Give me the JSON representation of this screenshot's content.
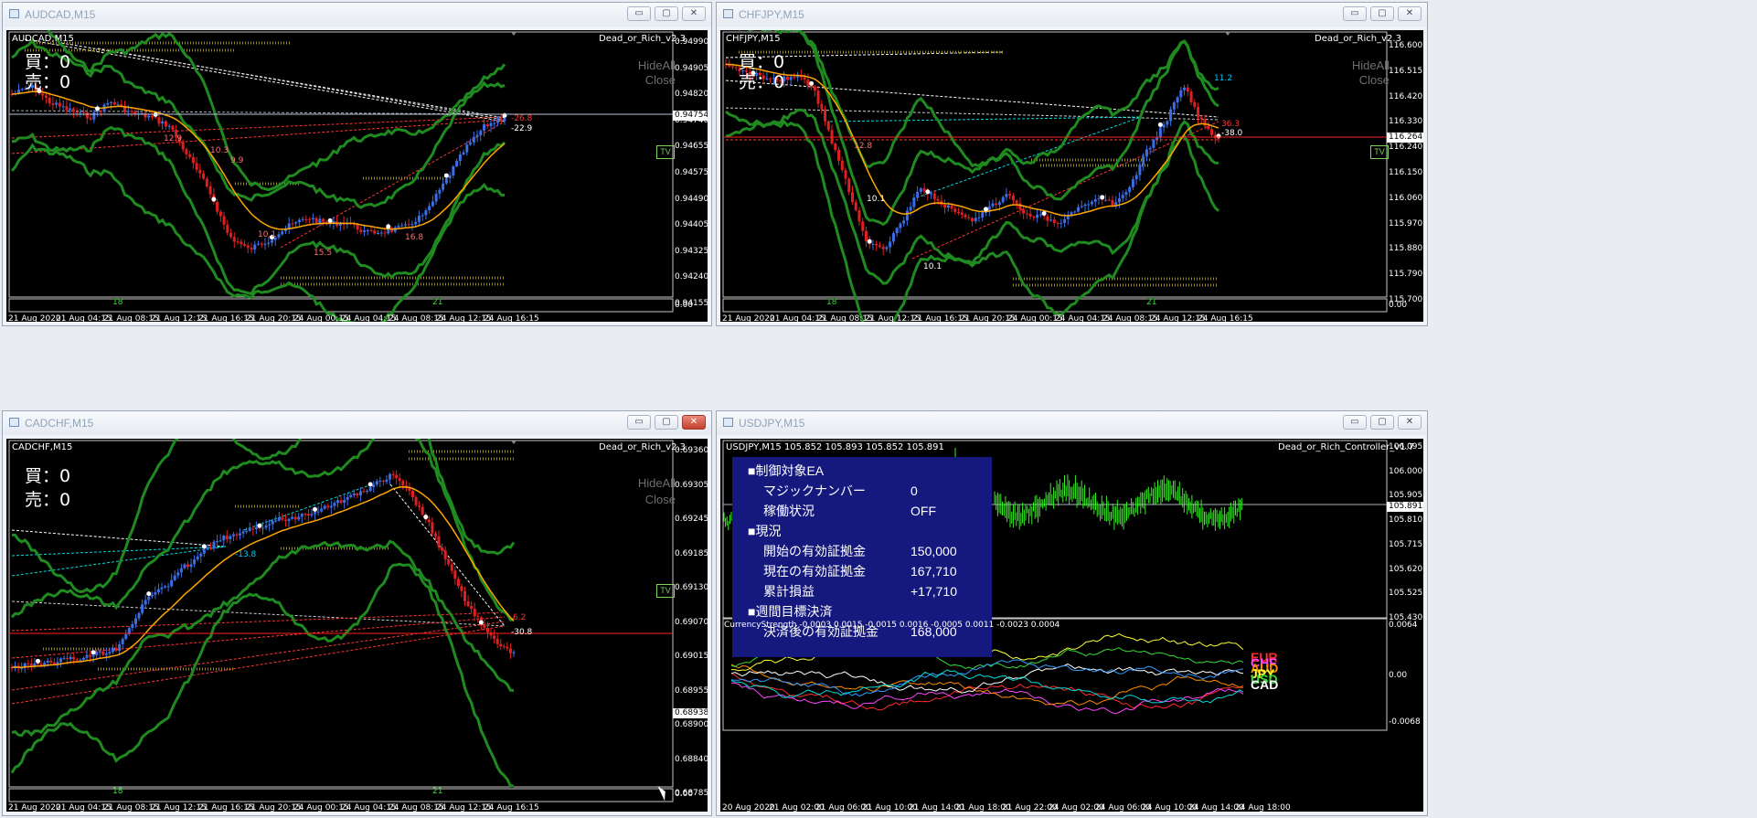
{
  "windows": {
    "audcad": {
      "title": "AUDCAD,M15",
      "symbol_label": "AUDCAD,M15",
      "ea_label": "Dead_or_Rich_v2.3",
      "buy": "買：0",
      "sell": "売：0",
      "hide_all": "HideAll",
      "close_all": "Close",
      "tv": "TV",
      "y_ticks": [
        "0.94990",
        "0.94905",
        "0.94820",
        "0.94740",
        "0.94655",
        "0.94575",
        "0.94490",
        "0.94405",
        "0.94325",
        "0.94240",
        "0.94155"
      ],
      "current_price": "0.94754",
      "x_ticks": [
        "21 Aug 2020",
        "21 Aug 04:15",
        "21 Aug 08:15",
        "21 Aug 12:15",
        "21 Aug 16:15",
        "21 Aug 20:15",
        "24 Aug 00:15",
        "24 Aug 04:15",
        "24 Aug 08:15",
        "24 Aug 12:15",
        "24 Aug 16:15"
      ],
      "sub_zero": "0.00",
      "sub_marks": [
        "18",
        "21"
      ],
      "annotations": [
        "12.9",
        "10.3",
        "9.9",
        "10.1",
        "15.5",
        "16.8",
        "-26.8",
        "-22.9"
      ]
    },
    "chfjpy": {
      "title": "CHFJPY,M15",
      "symbol_label": "CHFJPY,M15",
      "ea_label": "Dead_or_Rich_v2.3",
      "buy": "買：0",
      "sell": "売：0",
      "hide_all": "HideAll",
      "close_all": "Close",
      "tv": "TV",
      "y_ticks": [
        "116.600",
        "116.515",
        "116.420",
        "116.330",
        "116.240",
        "116.150",
        "116.060",
        "115.970",
        "115.880",
        "115.790",
        "115.700"
      ],
      "current_price": "116.264",
      "x_ticks": [
        "21 Aug 2020",
        "21 Aug 04:15",
        "21 Aug 08:15",
        "21 Aug 12:15",
        "21 Aug 16:15",
        "21 Aug 20:15",
        "24 Aug 00:15",
        "24 Aug 04:15",
        "24 Aug 08:15",
        "24 Aug 12:15",
        "24 Aug 16:15"
      ],
      "sub_zero": "0.00",
      "sub_marks": [
        "18",
        "21"
      ],
      "annotations": [
        "11.2",
        "12.8",
        "10.1",
        "10.1",
        "36.3",
        "-38.0"
      ]
    },
    "cadchf": {
      "title": "CADCHF,M15",
      "symbol_label": "CADCHF,M15",
      "ea_label": "Dead_or_Rich_v2.3",
      "buy": "買：0",
      "sell": "売：0",
      "hide_all": "HideAll",
      "close_all": "Close",
      "tv": "TV",
      "y_ticks": [
        "0.69360",
        "0.69305",
        "0.69245",
        "0.69185",
        "0.69130",
        "0.69070",
        "0.69015",
        "0.68955",
        "0.68900",
        "0.68840",
        "0.68785"
      ],
      "current_price": "0.68938",
      "x_ticks": [
        "21 Aug 2020",
        "21 Aug 04:15",
        "21 Aug 08:15",
        "21 Aug 12:15",
        "21 Aug 16:15",
        "21 Aug 20:15",
        "24 Aug 00:15",
        "24 Aug 04:15",
        "24 Aug 08:15",
        "24 Aug 12:15",
        "24 Aug 16:15"
      ],
      "sub_zero": "0.00",
      "sub_marks": [
        "18",
        "21"
      ],
      "annotations": [
        "-13.8",
        "6.2",
        "-30.8"
      ]
    },
    "usdjpy": {
      "title": "USDJPY,M15",
      "symbol_label": "USDJPY,M15  105.852 105.893 105.852 105.891",
      "ea_label": "Dead_or_Rich_Controller_v1.7",
      "y_ticks": [
        "106.095",
        "106.000",
        "105.905",
        "105.810",
        "105.715",
        "105.620",
        "105.525",
        "105.430"
      ],
      "current_price": "105.891",
      "panel": {
        "sec1": "■制御対象EA",
        "magic_label": "マジックナンバー",
        "magic_value": "0",
        "status_label": "稼働状況",
        "status_value": "OFF",
        "sec2": "■現況",
        "start_equity_label": "開始の有効証拠金",
        "start_equity_value": "150,000",
        "cur_equity_label": "現在の有効証拠金",
        "cur_equity_value": "167,710",
        "pnl_label": "累計損益",
        "pnl_value": "+17,710",
        "sec3": "■週間目標決済",
        "after_label": "決済後の有効証拠金",
        "after_value": "168,000"
      },
      "cs_label": "CurrencyStrength -0.0003 0.0015 -0.0015 0.0016 -0.0005 0.0011 -0.0023 0.0004",
      "cs_ticks": [
        "0.0064",
        "0.00",
        "-0.0068"
      ],
      "currencies": [
        {
          "name": "EUR",
          "color": "#ff2a2a"
        },
        {
          "name": "CHF",
          "color": "#ff44ff"
        },
        {
          "name": "AUD",
          "color": "#ff8c00"
        },
        {
          "name": "JPY",
          "color": "#ffff33"
        },
        {
          "name": "USD",
          "color": "#33dd33"
        },
        {
          "name": "CAD",
          "color": "#ffffff"
        }
      ],
      "x_ticks": [
        "20 Aug 2020",
        "21 Aug 02:00",
        "21 Aug 06:00",
        "21 Aug 10:00",
        "21 Aug 14:00",
        "21 Aug 18:00",
        "21 Aug 22:00",
        "24 Aug 02:00",
        "24 Aug 06:00",
        "24 Aug 10:00",
        "24 Aug 14:00",
        "24 Aug 18:00"
      ]
    }
  },
  "colors": {
    "bull": "#3b6ee6",
    "bear": "#e02020",
    "band": "#1f8a1f",
    "ma": "#ffa500"
  }
}
